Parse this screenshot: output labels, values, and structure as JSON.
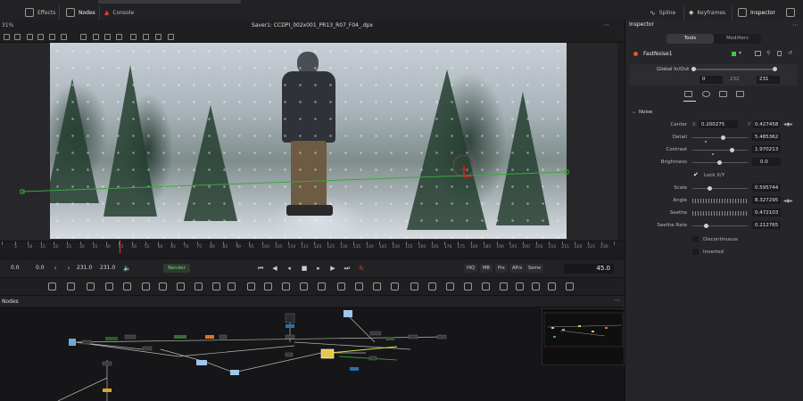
{
  "topbar": {
    "effects_label": "Effects",
    "nodes_label": "Nodes",
    "console_label": "Console",
    "spline_label": "Spline",
    "keyframes_label": "Keyframes",
    "inspector_label": "Inspector"
  },
  "viewer": {
    "zoom": "31%",
    "title": "Saver1: CCDPI_002x001_PR13_R07_F04_.dpx"
  },
  "ruler": {
    "ticks": [
      "5",
      "10",
      "15",
      "20",
      "25",
      "30",
      "35",
      "40",
      "45",
      "50",
      "55",
      "60",
      "65",
      "70",
      "75",
      "80",
      "85",
      "90",
      "95",
      "100",
      "105",
      "110",
      "115",
      "120",
      "125",
      "130",
      "135",
      "140",
      "145",
      "150",
      "155",
      "160",
      "165",
      "170",
      "175",
      "180",
      "185",
      "190",
      "195",
      "200",
      "205",
      "210",
      "215",
      "220",
      "225",
      "230"
    ]
  },
  "transport": {
    "start_time": "0.0",
    "render_start": "0.0",
    "end_time": "231.0",
    "render_end": "231.0",
    "render_label": "Render",
    "hiq": "HiQ",
    "mb": "MB",
    "prx": "Prx",
    "aprx": "APrx",
    "some": "Some",
    "current_frame": "45.0"
  },
  "nodes_panel": {
    "title": "Nodes"
  },
  "inspector": {
    "title": "Inspector",
    "tab_tools": "Tools",
    "tab_modifiers": "Modifiers",
    "node_name": "FastNoise1",
    "global_inout_label": "Global In/Out",
    "global_in": "0",
    "global_mid": "232",
    "global_out": "231",
    "section_noise": "Noise",
    "center_label": "Center",
    "center_x_label": "X",
    "center_x": "0.200275",
    "center_y_label": "Y",
    "center_y": "0.427458",
    "detail_label": "Detail",
    "detail": "5.485362",
    "contrast_label": "Contrast",
    "contrast": "1.970213",
    "brightness_label": "Brightness",
    "brightness": "0.0",
    "lock_xy_label": "Lock X/Y",
    "scale_label": "Scale",
    "scale": "0.595744",
    "angle_label": "Angle",
    "angle": "8.327295",
    "seethe_label": "Seethe",
    "seethe": "0.472103",
    "seethe_rate_label": "Seethe Rate",
    "seethe_rate": "0.212765",
    "discontinuous_label": "Discontinuous",
    "inverted_label": "Inverted"
  },
  "colors": {
    "accent_red": "#e34234",
    "render_green": "#7fcf7f",
    "node_orange": "#e8582b"
  }
}
